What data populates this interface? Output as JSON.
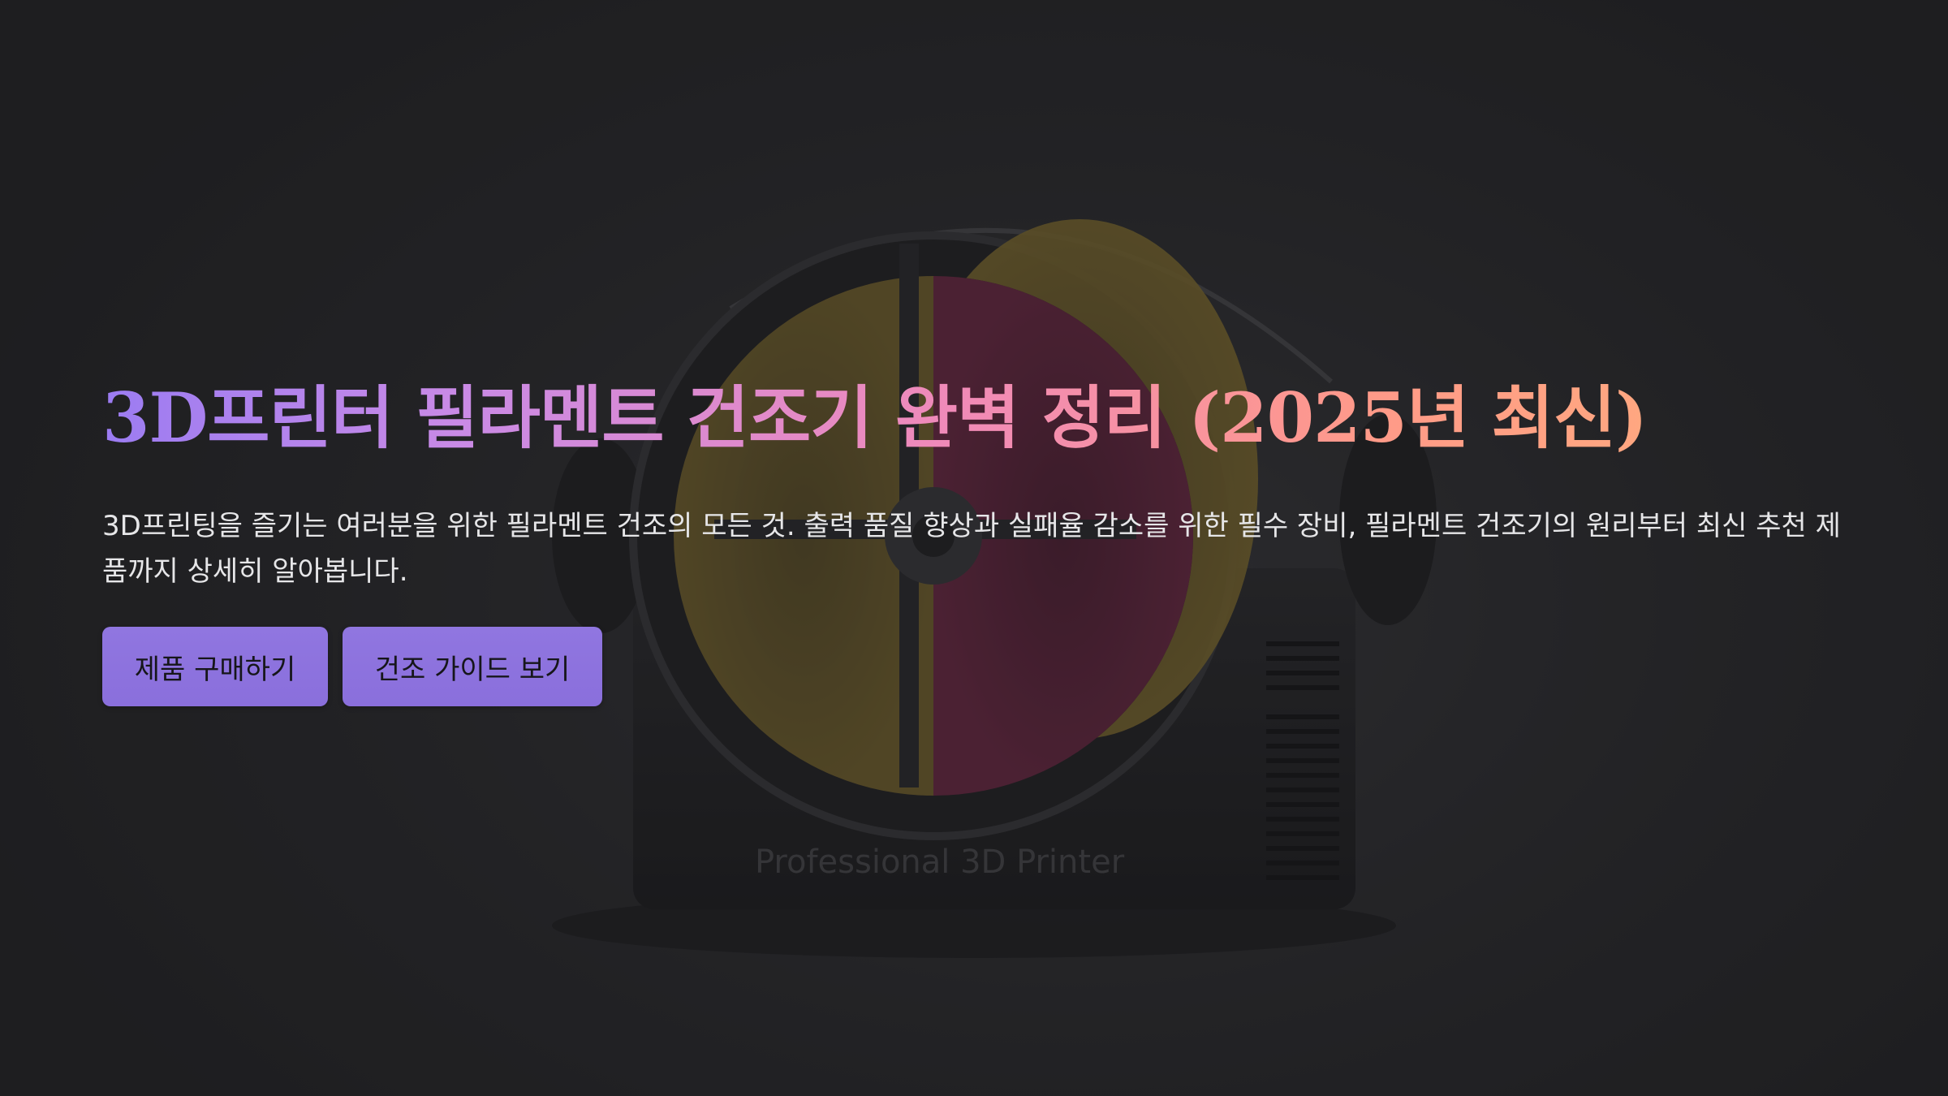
{
  "hero": {
    "title": "3D프린터 필라멘트 건조기 완벽 정리 (2025년 최신)",
    "description": "3D프린팅을 즐기는 여러분을 위한 필라멘트 건조의 모든 것. 출력 품질 향상과 실패율 감소를 위한 필수 장비, 필라멘트 건조기의 원리부터 최신 추천 제품까지 상세히 알아봅니다.",
    "buttons": {
      "primary_label": "제품 구매하기",
      "secondary_label": "건조 가이드 보기"
    }
  },
  "background_image": {
    "printed_text": "Professional 3D Printer"
  },
  "colors": {
    "title_gradient": [
      "#9b7cf2",
      "#f08ab8",
      "#ffb27a"
    ],
    "button_bg": "#8a6fdc",
    "page_bg": "#2a2a2c"
  }
}
